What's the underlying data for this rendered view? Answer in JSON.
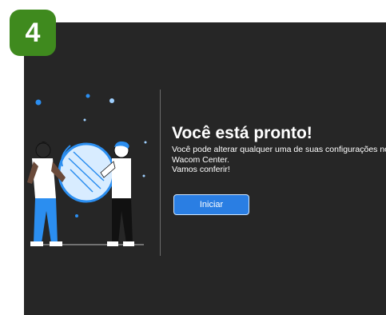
{
  "step_number": "4",
  "dialog": {
    "title": "Você está pronto!",
    "description_line1": "Você pode alterar qualquer uma de suas configurações no",
    "description_line2": "Wacom Center.",
    "description_line3": "Vamos conferir!",
    "start_button_label": "Iniciar"
  },
  "colors": {
    "badge": "#3f8a1e",
    "background": "#262626",
    "button": "#2a7ee3",
    "accent_blue": "#2b8ef0"
  },
  "icons": {
    "illustration": "two-people-holding-mirror-illustration"
  }
}
